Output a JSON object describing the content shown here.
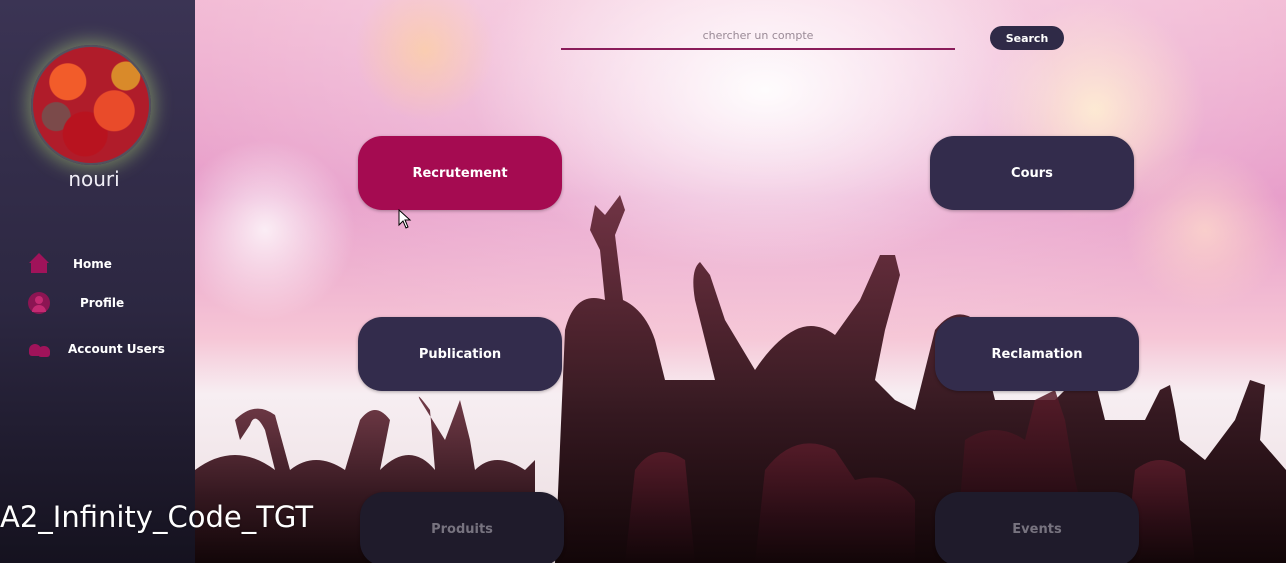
{
  "sidebar": {
    "username": "nouri",
    "items": [
      {
        "label": "Home",
        "icon": "home-icon"
      },
      {
        "label": "Profile",
        "icon": "profile-icon"
      },
      {
        "label": "Account Users",
        "icon": "users-icon"
      }
    ]
  },
  "search": {
    "placeholder": "chercher un compte",
    "value": "",
    "button_label": "Search"
  },
  "tiles": {
    "recrutement": "Recrutement",
    "cours": "Cours",
    "publication": "Publication",
    "reclamation": "Reclamation",
    "produits": "Produits",
    "events": "Events"
  },
  "watermark": "A2_Infinity_Code_TGT",
  "colors": {
    "accent": "#a50b51",
    "tile": "#332c4c",
    "sidebar": "#2c2741"
  }
}
